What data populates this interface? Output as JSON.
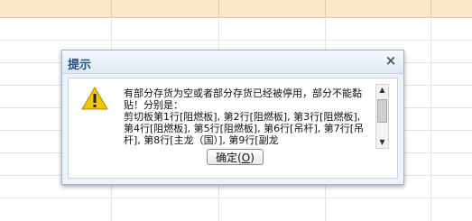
{
  "dialog": {
    "title": "提示",
    "close_glyph": "×",
    "message": "有部分存货为空或者部分存货已经被停用，部分不能黏贴！分别是：\n剪切板第1行[阻燃板], 第2行[阻燃板], 第3行[阻燃板], 第4行[阻燃板], 第5行[阻燃板], 第6行[吊杆], 第7行[吊杆], 第8行[主龙（国）], 第9行[副龙",
    "ok_label": "确定(",
    "ok_mnemonic": "O",
    "ok_suffix": ")",
    "warning_icon": "warning-icon"
  },
  "colors": {
    "sheet_header": "#fbe7c8",
    "dialog_bg": "#eef3fa",
    "title_text": "#1f4e86",
    "warning": "#f5c400"
  }
}
